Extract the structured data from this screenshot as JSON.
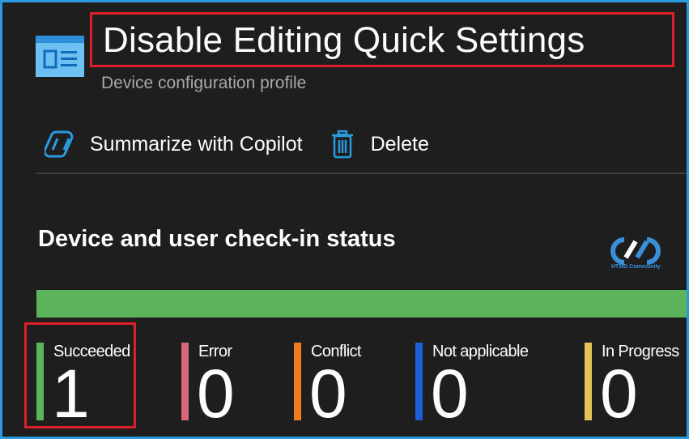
{
  "header": {
    "title": "Disable Editing Quick Settings",
    "subtitle": "Device configuration profile",
    "icon": "profile-window-icon"
  },
  "toolbar": {
    "summarize_label": "Summarize with Copilot",
    "summarize_icon": "copilot-icon",
    "delete_label": "Delete",
    "delete_icon": "trash-icon"
  },
  "section": {
    "title": "Device and user check-in status"
  },
  "watermark": {
    "text": "HTMD Community"
  },
  "progress": {
    "succeeded_fraction": 1.0,
    "color": "#5bb45a"
  },
  "stats": [
    {
      "label": "Succeeded",
      "count": "1",
      "color": "#5bb45a"
    },
    {
      "label": "Error",
      "count": "0",
      "color": "#d9677a"
    },
    {
      "label": "Conflict",
      "count": "0",
      "color": "#f07d1e"
    },
    {
      "label": "Not applicable",
      "count": "0",
      "color": "#1a5fd6"
    },
    {
      "label": "In Progress",
      "count": "0",
      "color": "#e3c25a"
    }
  ],
  "colors": {
    "accent": "#2b9be0",
    "highlight": "#e01e2b",
    "background": "#1e1e1e"
  }
}
